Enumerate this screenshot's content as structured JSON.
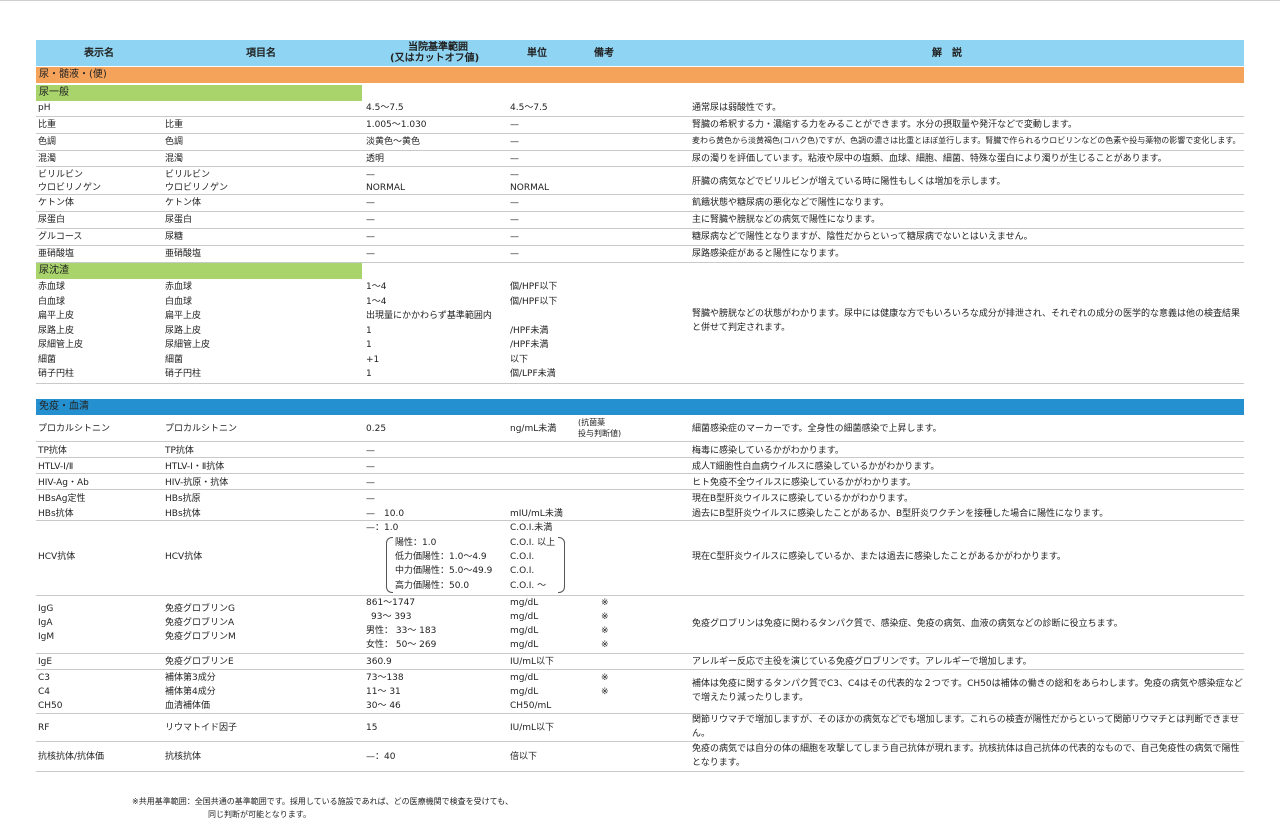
{
  "header": {
    "col_name": "表示名",
    "col_item": "項目名",
    "col_range_l1": "当院基準範囲",
    "col_range_l2": "(又はカットオフ値)",
    "col_unit": "単位",
    "col_note": "備考",
    "col_expl": "解　説"
  },
  "section_urine": "尿・髄液・(便)",
  "sub_general": "尿一般",
  "sub_sediment": "尿沈渣",
  "section_immune": "免疫・血清",
  "urine_rows": [
    {
      "name": "pH",
      "item": "",
      "range": "4.5〜7.5",
      "unit": "4.5〜7.5",
      "expl": "通常尿は弱酸性です。"
    },
    {
      "name": "比重",
      "item": "比重",
      "range": "1.005〜1.030",
      "unit": "—",
      "expl": "腎臓の希釈する力・濃縮する力をみることができます。水分の摂取量や発汗などで変動します。"
    },
    {
      "name": "色調",
      "item": "色調",
      "range": "淡黄色〜黄色",
      "unit": "—",
      "expl": "麦わら黄色から淡黄褐色(コハク色)ですが、色調の濃さは比重とほぼ並行します。腎臓で作られるウロビリンなどの色素や投与薬物の影響で変化します。"
    },
    {
      "name": "混濁",
      "item": "混濁",
      "range": "透明",
      "unit": "—",
      "expl": "尿の濁りを評価しています。粘液や尿中の塩類、血球、細胞、細菌、特殊な蛋白により濁りが生じることがあります。"
    },
    {
      "name": "ビリルビン",
      "item": "ビリルビン",
      "range": "—",
      "unit": "—",
      "expl": ""
    },
    {
      "name": "ウロビリノゲン",
      "item": "ウロビリノゲン",
      "range": "NORMAL",
      "unit": "NORMAL",
      "expl": ""
    },
    {
      "name": "ケトン体",
      "item": "ケトン体",
      "range": "—",
      "unit": "—",
      "expl": "飢餓状態や糖尿病の悪化などで陽性になります。"
    },
    {
      "name": "尿蛋白",
      "item": "尿蛋白",
      "range": "—",
      "unit": "—",
      "expl": "主に腎臓や膀胱などの病気で陽性になります。"
    },
    {
      "name": "グルコース",
      "item": "尿糖",
      "range": "—",
      "unit": "—",
      "expl": "糖尿病などで陽性となりますが、陰性だからといって糖尿病でないとはいえません。"
    },
    {
      "name": "亜硝酸塩",
      "item": "亜硝酸塩",
      "range": "—",
      "unit": "—",
      "expl": "尿路感染症があると陽性になります。"
    }
  ],
  "bili_expl": "肝臓の病気などでビリルビンが増えている時に陽性もしくは増加を示します。",
  "sediment_rows": [
    {
      "name": "赤血球",
      "item": "赤血球",
      "range": "1〜4",
      "unit": "個/HPF以下"
    },
    {
      "name": "白血球",
      "item": "白血球",
      "range": "1〜4",
      "unit": "個/HPF以下"
    },
    {
      "name": "扁平上皮",
      "item": "扁平上皮",
      "range": "出現量にかかわらず基準範囲内",
      "unit": ""
    },
    {
      "name": "尿路上皮",
      "item": "尿路上皮",
      "range": "1",
      "unit": "/HPF未満"
    },
    {
      "name": "尿細管上皮",
      "item": "尿細管上皮",
      "range": "1",
      "unit": "/HPF未満"
    },
    {
      "name": "細菌",
      "item": "細菌",
      "range": "+1",
      "unit": "以下"
    },
    {
      "name": "硝子円柱",
      "item": "硝子円柱",
      "range": "1",
      "unit": "個/LPF未満"
    }
  ],
  "sediment_expl": "腎臓や膀胱などの状態がわかります。尿中には健康な方でもいろいろな成分が排泄され、それぞれの成分の医学的な意義は他の検査結果と併せて判定されます。",
  "immune_rows": [
    {
      "name": "プロカルシトニン",
      "item": "プロカルシトニン",
      "range": "0.25",
      "unit": "ng/mL未満",
      "note": "(抗菌薬\n投与判断値)",
      "expl": "細菌感染症のマーカーです。全身性の細菌感染で上昇します。"
    },
    {
      "name": "TP抗体",
      "item": "TP抗体",
      "range": "—",
      "unit": "",
      "note": "",
      "expl": "梅毒に感染しているかがわかります。"
    },
    {
      "name": "HTLV-Ⅰ/Ⅱ",
      "item": "HTLV-Ⅰ・Ⅱ抗体",
      "range": "—",
      "unit": "",
      "note": "",
      "expl": "成人T細胞性白血病ウイルスに感染しているかがわかります。"
    },
    {
      "name": "HIV-Ag・Ab",
      "item": "HIV-抗原・抗体",
      "range": "—",
      "unit": "",
      "note": "",
      "expl": "ヒト免疫不全ウイルスに感染しているかがわかります。"
    },
    {
      "name": "HBsAg定性",
      "item": "HBs抗原",
      "range": "—",
      "unit": "",
      "note": "",
      "expl": "現在B型肝炎ウイルスに感染しているかがわかります。"
    },
    {
      "name": "HBs抗体",
      "item": "HBs抗体",
      "range": "—　10.0",
      "unit": "mIU/mL未満",
      "note": "",
      "expl": "過去にB型肝炎ウイルスに感染したことがあるか、B型肝炎ワクチンを接種した場合に陽性になります。"
    }
  ],
  "hcv": {
    "name": "HCV抗体",
    "item": "HCV抗体",
    "range_top": "—：1.0",
    "unit_top": "C.O.I.未満",
    "levels": [
      {
        "label": "陽性：1.0",
        "unit": "C.O.I. 以上"
      },
      {
        "label": "低力価陽性：1.0〜4.9",
        "unit": "C.O.I."
      },
      {
        "label": "中力価陽性：5.0〜49.9",
        "unit": "C.O.I."
      },
      {
        "label": "高力価陽性：50.0",
        "unit": "C.O.I. 〜"
      }
    ],
    "expl": "現在C型肝炎ウイルスに感染しているか、または過去に感染したことがあるかがわかります。"
  },
  "ig": {
    "names": [
      "IgG",
      "IgA",
      "IgM"
    ],
    "items": [
      "免疫グロブリンG",
      "免疫グロブリンA",
      "免疫グロブリンM"
    ],
    "ranges": [
      "861〜1747",
      "93〜  393",
      "男性：  33〜  183",
      "女性：  50〜  269"
    ],
    "units": [
      "mg/dL",
      "mg/dL",
      "mg/dL",
      "mg/dL"
    ],
    "notes": [
      "※",
      "※",
      "※",
      "※"
    ],
    "expl": "免疫グロブリンは免疫に関わるタンパク質で、感染症、免疫の病気、血液の病気などの診断に役立ちます。"
  },
  "ige": {
    "name": "IgE",
    "item": "免疫グロブリンE",
    "range": "360.9",
    "unit": "IU/mL以下",
    "expl": "アレルギー反応で主役を演じている免疫グロブリンです。アレルギーで増加します。"
  },
  "complement": {
    "rows": [
      {
        "name": "C3",
        "item": "補体第3成分",
        "range": "73〜138",
        "unit": "mg/dL",
        "note": "※"
      },
      {
        "name": "C4",
        "item": "補体第4成分",
        "range": "11〜  31",
        "unit": "mg/dL",
        "note": "※"
      },
      {
        "name": "CH50",
        "item": "血清補体価",
        "range": "30〜  46",
        "unit": "CH50/mL",
        "note": ""
      }
    ],
    "expl": "補体は免疫に関するタンパク質でC3、C4はその代表的な２つです。CH50は補体の働きの総和をあらわします。免疫の病気や感染症などで増えたり減ったりします。"
  },
  "rf": {
    "name": "RF",
    "item": "リウマトイド因子",
    "range": "15",
    "unit": "IU/mL以下",
    "expl": "関節リウマチで増加しますが、そのほかの病気などでも増加します。これらの検査が陽性だからといって関節リウマチとは判断できません。"
  },
  "ana": {
    "name": "抗核抗体/抗体価",
    "item": "抗核抗体",
    "range": "—：40",
    "unit": "倍以下",
    "expl": "免疫の病気では自分の体の細胞を攻撃してしまう自己抗体が現れます。抗核抗体は自己抗体の代表的なもので、自己免疫性の病気で陽性となります。"
  },
  "footnote_l1": "※共用基準範囲：全国共通の基準範囲です。採用している施設であれば、どの医療機関で検査を受けても、",
  "footnote_l2": "同じ判断が可能となります。"
}
